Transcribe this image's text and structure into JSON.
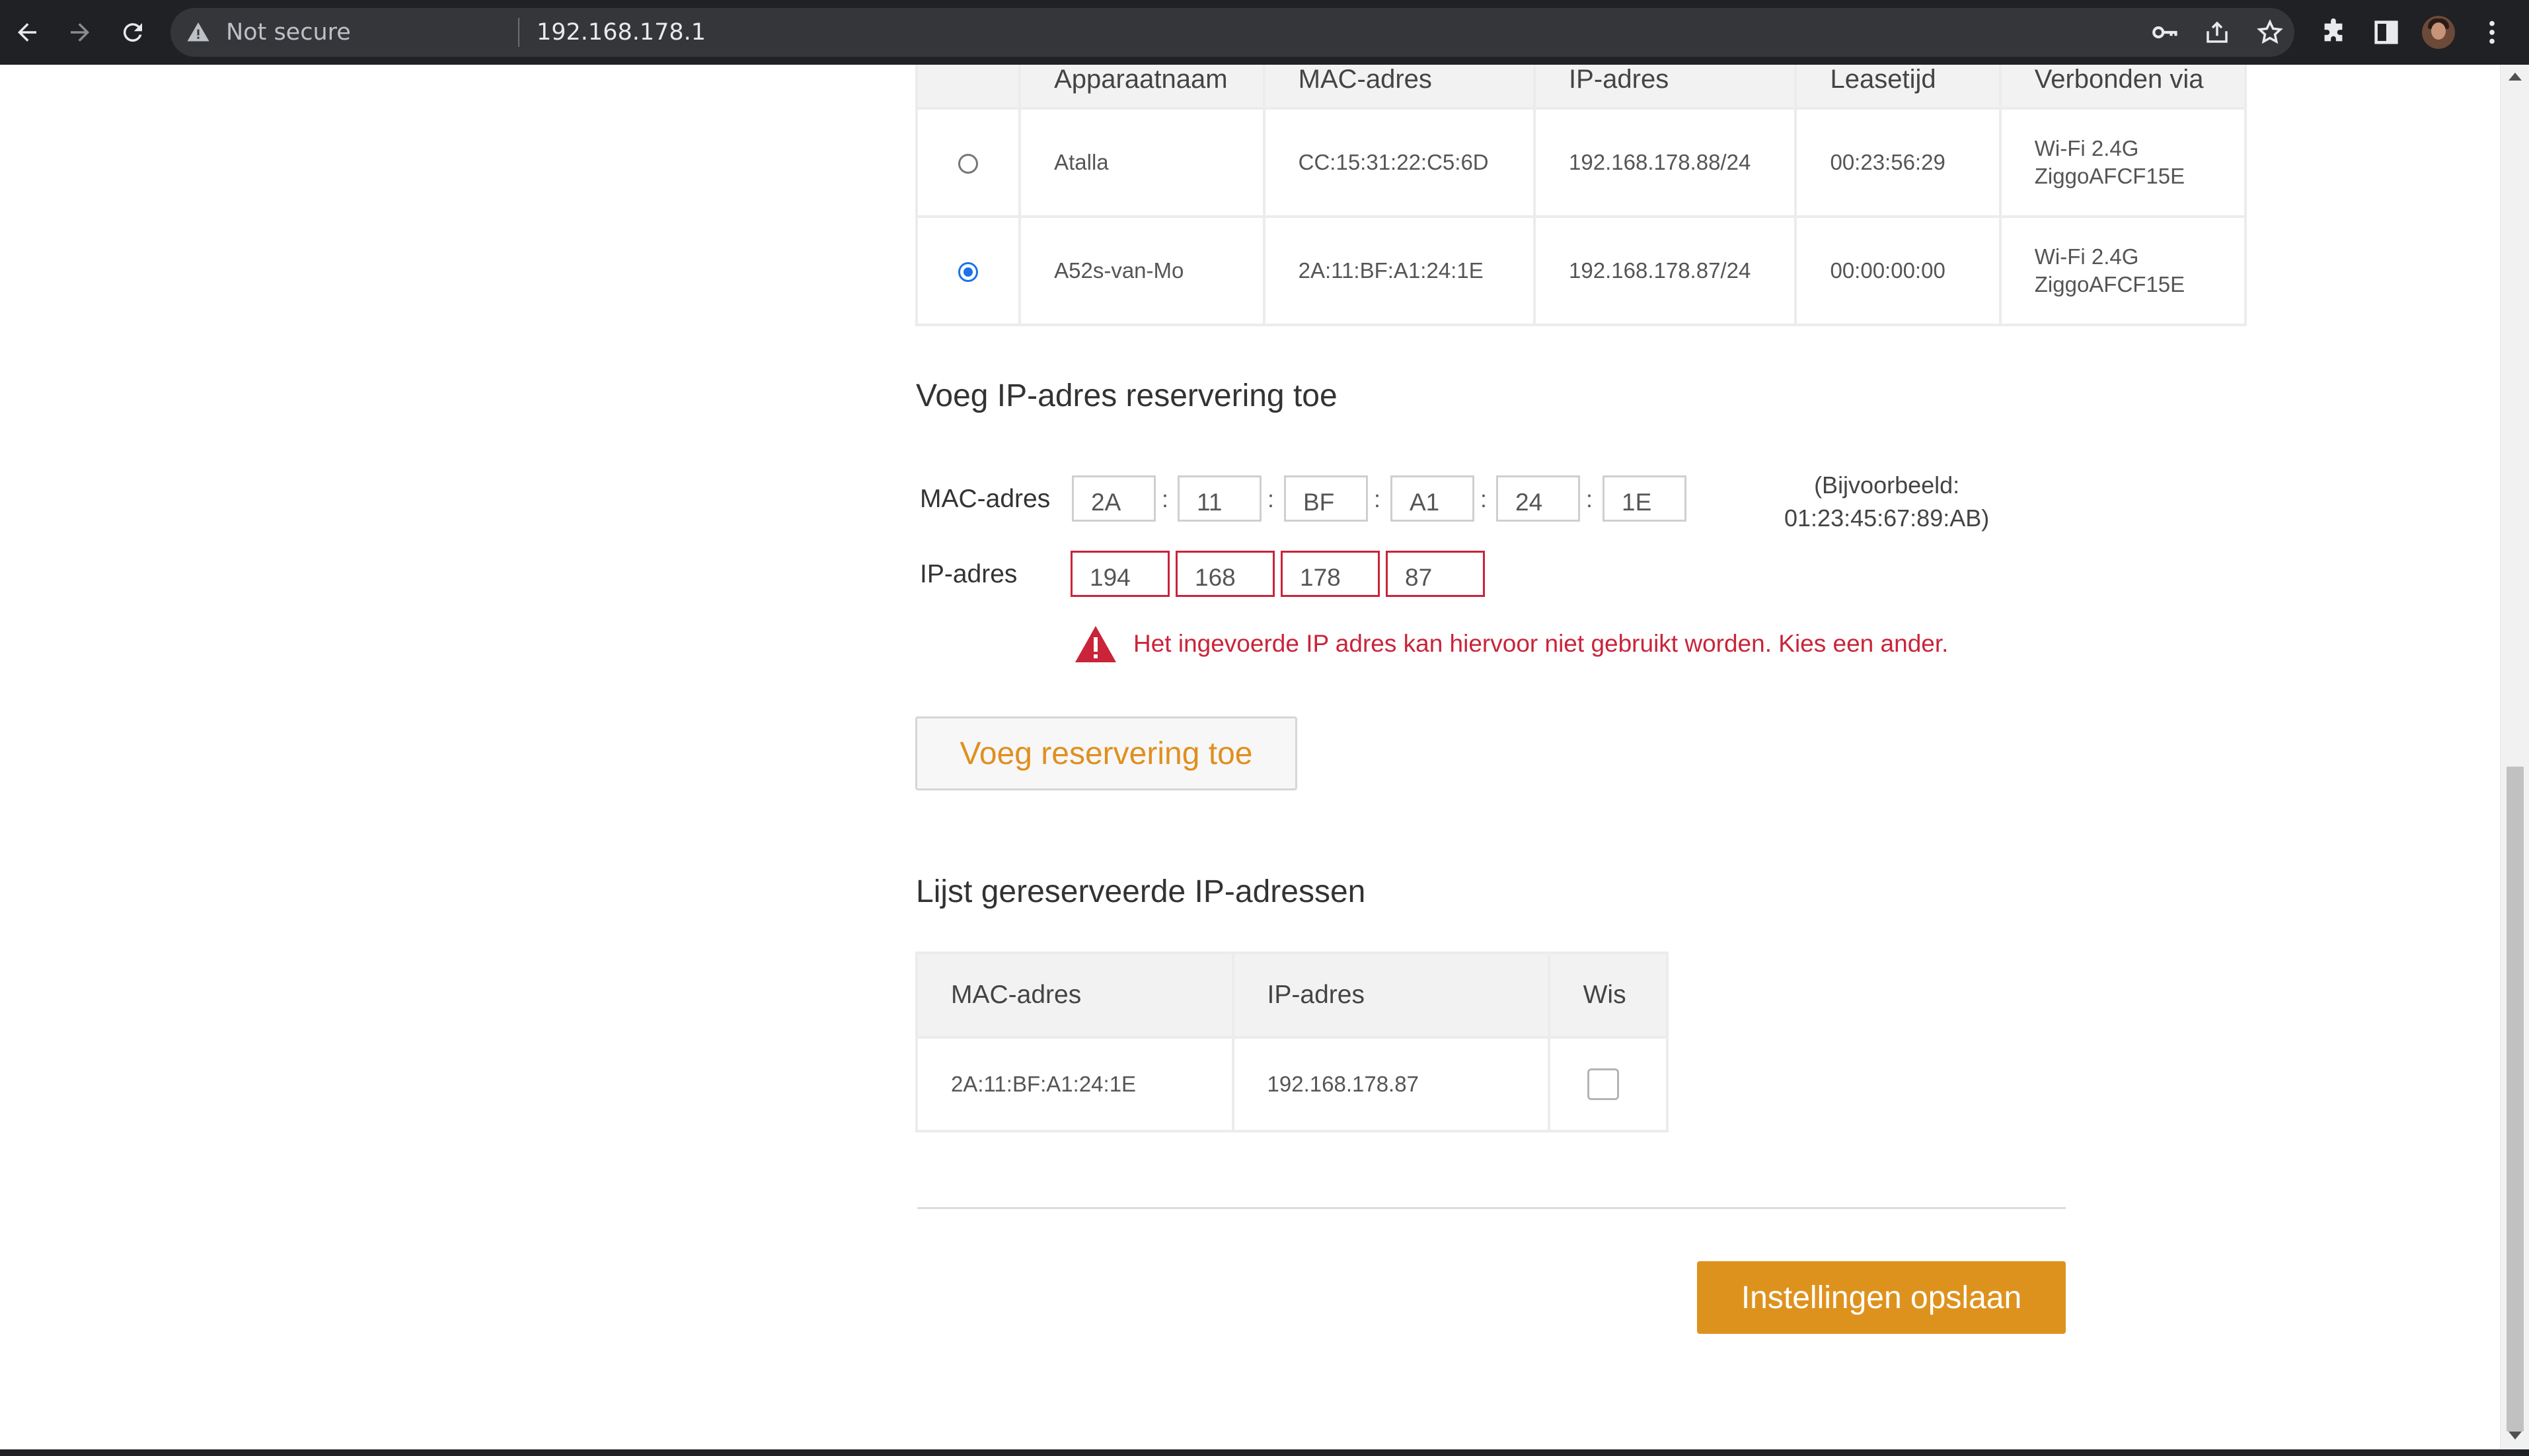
{
  "browser": {
    "security_label": "Not secure",
    "url": "192.168.178.1",
    "icons": [
      "back-arrow-icon",
      "forward-arrow-icon",
      "reload-icon",
      "warning-triangle-icon",
      "key-icon",
      "share-icon",
      "star-icon",
      "puzzle-extension-icon",
      "side-panel-icon",
      "profile-avatar",
      "more-vert-icon"
    ]
  },
  "devices_table": {
    "headers": [
      "",
      "Apparaatnaam",
      "MAC-adres",
      "IP-adres",
      "Leasetijd",
      "Verbonden via"
    ],
    "rows": [
      {
        "selected": false,
        "name": "Atalla",
        "mac": "CC:15:31:22:C5:6D",
        "ip": "192.168.178.88/24",
        "lease": "00:23:56:29",
        "via_line1": "Wi-Fi 2.4G",
        "via_line2": "ZiggoAFCF15E"
      },
      {
        "selected": true,
        "name": "A52s-van-Mo",
        "mac": "2A:11:BF:A1:24:1E",
        "ip": "192.168.178.87/24",
        "lease": "00:00:00:00",
        "via_line1": "Wi-Fi 2.4G",
        "via_line2": "ZiggoAFCF15E"
      }
    ]
  },
  "add_reservation": {
    "title": "Voeg IP-adres reservering toe",
    "mac_label": "MAC-adres",
    "mac_octets": [
      "2A",
      "11",
      "BF",
      "A1",
      "24",
      "1E"
    ],
    "separator": ":",
    "example_line1": "(Bijvoorbeeld:",
    "example_line2": "01:23:45:67:89:AB)",
    "ip_label": "IP-adres",
    "ip_octets": [
      "194",
      "168",
      "178",
      "87"
    ],
    "error_message": "Het ingevoerde IP adres kan hiervoor niet gebruikt worden. Kies een ander.",
    "error_color": "#c9243a",
    "add_button": "Voeg reservering toe"
  },
  "reserved_list": {
    "title": "Lijst gereserveerde IP-adressen",
    "headers": [
      "MAC-adres",
      "IP-adres",
      "Wis"
    ],
    "rows": [
      {
        "mac": "2A:11:BF:A1:24:1E",
        "ip": "192.168.178.87",
        "delete_checked": false
      }
    ]
  },
  "save_button": "Instellingen opslaan",
  "accent_color": "#de921e"
}
